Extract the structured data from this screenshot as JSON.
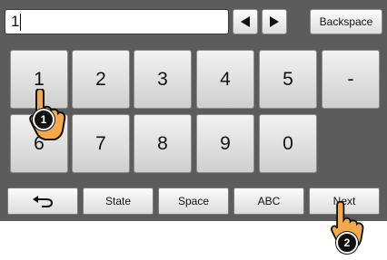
{
  "input": {
    "value": "1"
  },
  "toolbar": {
    "left_arrow": "left-arrow-icon",
    "right_arrow": "right-arrow-icon",
    "backspace_label": "Backspace"
  },
  "keypad": {
    "row1": [
      "1",
      "2",
      "3",
      "4",
      "5",
      "-"
    ],
    "row2": [
      "6",
      "7",
      "8",
      "9",
      "0"
    ]
  },
  "function_row": {
    "back_icon": "return-arrow-icon",
    "state_label": "State",
    "space_label": "Space",
    "abc_label": "ABC",
    "next_label": "Next"
  },
  "callouts": {
    "first": "1",
    "second": "2"
  },
  "colors": {
    "panel_bg": "#5c5c5c",
    "key_face": "#e6e6e6",
    "callout_bg": "#111111"
  }
}
